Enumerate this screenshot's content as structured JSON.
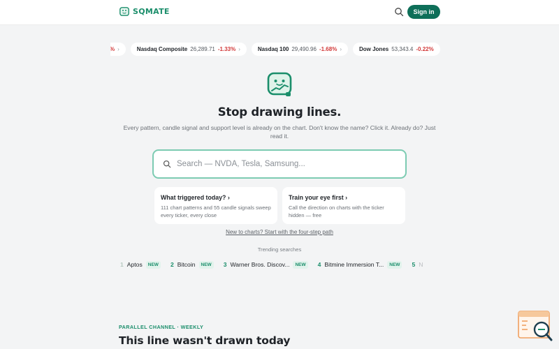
{
  "header": {
    "brand": "SQMATE",
    "signin_label": "Sign in",
    "icons": {
      "logo": "sqmate-logo-icon",
      "search": "search-icon"
    }
  },
  "ticker": [
    {
      "change": "%"
    },
    {
      "name": "Nasdaq Composite",
      "price": "26,289.71",
      "change": "-1.33%"
    },
    {
      "name": "Nasdaq 100",
      "price": "29,490.96",
      "change": "-1.68%"
    },
    {
      "name": "Dow Jones",
      "price": "53,343.4",
      "change": "-0.22%"
    }
  ],
  "hero": {
    "title": "Stop drawing lines.",
    "subtitle": "Every pattern, candle signal and support level is already on the chart. Don't know the name? Click it. Already do? Just read it."
  },
  "search": {
    "placeholder": "Search — NVDA, Tesla, Samsung..."
  },
  "cards": [
    {
      "title": "What triggered today?",
      "desc": "111 chart patterns and 55 candle signals sweep every ticker, every close"
    },
    {
      "title": "Train your eye first",
      "desc": "Call the direction on charts with the ticker hidden — free"
    }
  ],
  "path_link": "New to charts? Start with the four-step path",
  "trending": {
    "label": "Trending searches",
    "items": [
      {
        "num": "1",
        "name": "Aptos",
        "badge": "NEW"
      },
      {
        "num": "2",
        "name": "Bitcoin",
        "badge": "NEW"
      },
      {
        "num": "3",
        "name": "Warner Bros. Discov...",
        "badge": "NEW"
      },
      {
        "num": "4",
        "name": "Bitmine Immersion T...",
        "badge": "NEW"
      },
      {
        "num": "5",
        "name": "N"
      }
    ]
  },
  "section": {
    "tag": "PARALLEL CHANNEL · WEEKLY",
    "title": "This line wasn't drawn today"
  },
  "colors": {
    "brand": "#1b8e6b",
    "signin_bg": "#0e6f59",
    "negative": "#d23a3a",
    "search_border": "#7ccbb2"
  }
}
